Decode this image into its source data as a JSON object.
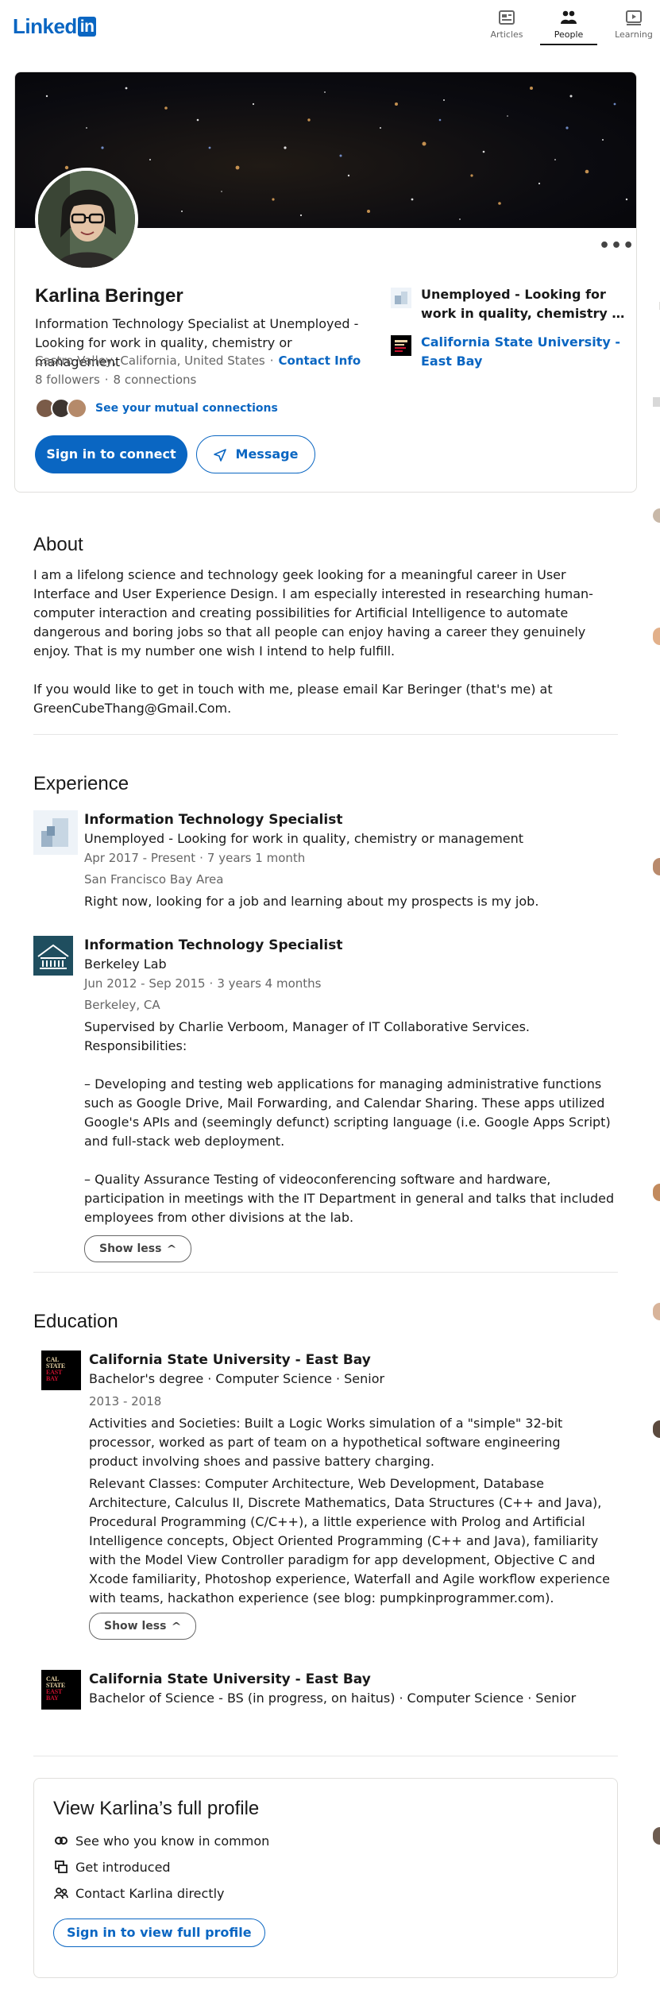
{
  "nav": {
    "logo_text": "Linked",
    "logo_box": "in",
    "items": [
      {
        "label": "Articles",
        "icon": "articles-icon"
      },
      {
        "label": "People",
        "icon": "people-icon"
      },
      {
        "label": "Learning",
        "icon": "learning-icon"
      }
    ],
    "active": "People"
  },
  "profile": {
    "name": "Karlina Beringer",
    "headline": "Information Technology Specialist at Unemployed - Looking for work in quality, chemistry or management",
    "location": "Castro Valley, California, United States",
    "contact_info": "Contact Info",
    "followers": "8 followers",
    "connections": "8 connections",
    "mutual": "See your mutual connections",
    "connect_button": "Sign in to connect",
    "message_button": "Message",
    "current_company": "Unemployed - Looking for work in quality, chemistry or management",
    "education": "California State University - East Bay"
  },
  "about": {
    "title": "About",
    "p1": "I am a lifelong science and technology geek looking for a meaningful career in User Interface and User Experience Design. I am especially interested in researching human-computer interaction and creating possibilities for Artificial Intelligence to automate dangerous and boring jobs so that all people can enjoy having a career they genuinely enjoy. That is my number one wish I intend to help fulfill.",
    "p2": "If you would like to get in touch with me, please email Kar Beringer (that's me) at GreenCubeThang@Gmail.Com."
  },
  "experience": {
    "title": "Experience",
    "items": [
      {
        "title": "Information Technology Specialist",
        "company": "Unemployed - Looking for work in quality, chemistry or management",
        "dates": "Apr 2017 - Present",
        "duration": "7 years 1 month",
        "location": "San Francisco Bay Area",
        "description": "Right now, looking for a job and learning about my prospects is my job."
      },
      {
        "title": "Information Technology Specialist",
        "company": "Berkeley Lab",
        "dates": "Jun 2012 - Sep 2015",
        "duration": "3 years 4 months",
        "location": "Berkeley, CA",
        "d1": "Supervised by Charlie Verboom, Manager of IT Collaborative Services. Responsibilities:",
        "d2": "– Developing and testing web applications for managing administrative functions such as Google Drive, Mail Forwarding, and Calendar Sharing. These apps utilized Google's APIs and (seemingly defunct) scripting language (i.e. Google Apps Script) and full-stack web deployment.",
        "d3": "– Quality Assurance Testing of videoconferencing software and hardware, participation in meetings with the IT Department in general and talks that included employees from other divisions at the lab.",
        "show_less": "Show less"
      }
    ]
  },
  "education": {
    "title": "Education",
    "items": [
      {
        "school": "California State University - East Bay",
        "degree": "Bachelor's degree",
        "field": "Computer Science",
        "grade": "Senior",
        "dates": "2013 - 2018",
        "activities": "Activities and Societies: Built a Logic Works simulation of a \"simple\" 32-bit processor, worked as part of team on a hypothetical software engineering product involving shoes and passive battery charging.",
        "classes": "Relevant Classes: Computer Architecture, Web Development, Database Architecture, Calculus II, Discrete Mathematics, Data Structures (C++ and Java), Procedural Programming (C/C++), a little experience with Prolog and Artificial Intelligence concepts, Object Oriented Programming (C++ and Java), familiarity with the Model View Controller paradigm for app development, Objective C and Xcode familiarity, Photoshop experience, Waterfall and Agile workflow experience with teams, hackathon experience (see blog: pumpkinprogrammer.com).",
        "show_less": "Show less"
      },
      {
        "school": "California State University - East Bay",
        "degree": "Bachelor of Science - BS (in progress, on haitus)",
        "field": "Computer Science",
        "grade": "Senior"
      }
    ],
    "logo_lines": [
      "CAL",
      "STATE",
      "EAST",
      "BAY"
    ]
  },
  "full_profile": {
    "title": "View Karlina’s full profile",
    "items": [
      "See who you know in common",
      "Get introduced",
      "Contact Karlina directly"
    ],
    "button": "Sign in to view full profile"
  },
  "colors": {
    "brand": "#0a66c2",
    "text": "#191919",
    "muted": "#666666"
  }
}
